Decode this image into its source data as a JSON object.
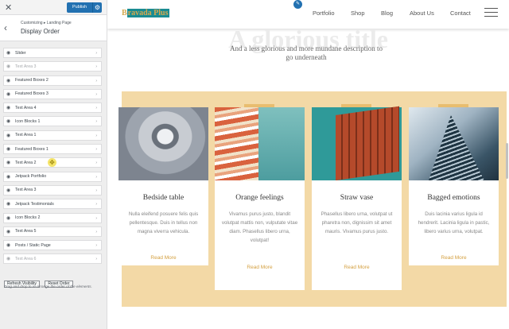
{
  "customizer": {
    "close_icon": "close-icon",
    "publish_label": "Publish",
    "gear_icon": "gear-icon",
    "breadcrumb": "Customizing ▸ Landing Page",
    "panel_title": "Display Order",
    "items": [
      {
        "label": "Slider",
        "visible": true
      },
      {
        "label": "Text Area 3",
        "visible": false
      },
      {
        "label": "Featured Boxes 2",
        "visible": true
      },
      {
        "label": "Featured Boxes 3",
        "visible": true
      },
      {
        "label": "Text Area 4",
        "visible": true
      },
      {
        "label": "Icon Blocks 1",
        "visible": true
      },
      {
        "label": "Text Area 1",
        "visible": true
      },
      {
        "label": "Featured Boxes 1",
        "visible": true
      },
      {
        "label": "Text Area 2",
        "visible": true
      },
      {
        "label": "Jetpack Portfolio",
        "visible": true
      },
      {
        "label": "Text Area 3",
        "visible": true
      },
      {
        "label": "Jetpack Testimonials",
        "visible": true
      },
      {
        "label": "Icon Blocks 2",
        "visible": true
      },
      {
        "label": "Text Area 5",
        "visible": true
      },
      {
        "label": "Posts / Static Page",
        "visible": true
      },
      {
        "label": "Text Area 6",
        "visible": false
      }
    ],
    "refresh_label": "Refresh Visibility",
    "reset_label": "Reset Order",
    "description": "Drag and drop to re-arrange the order of the elements."
  },
  "site": {
    "logo_prefix": "B",
    "logo_highlight": "ravada Plus",
    "nav": [
      "Portfolio",
      "Shop",
      "Blog",
      "About Us",
      "Contact"
    ],
    "hero_title": "A glorious title",
    "hero_subtitle": "And a less glorious and more mundane description to go underneath",
    "accent_color": "#d4a041",
    "band_color": "#f3d9a6",
    "cards": [
      {
        "title": "Bedside table",
        "desc": "Nulla eleifend posuere felis quis pellentesque. Duis in tellus non magna viverra vehicula.",
        "link": "Read More"
      },
      {
        "title": "Orange feelings",
        "desc": "Vivamus purus justo, blandit volutpat mattis non, vulputate vitae diam. Phasellus libero urna, volutpat!",
        "link": "Read More"
      },
      {
        "title": "Straw vase",
        "desc": "Phasellus libero urna, volutpat ut pharetra non, dignissim sit amet mauris. Vivamus purus justo.",
        "link": "Read More"
      },
      {
        "title": "Bagged emotions",
        "desc": "Duis lacinia varius ligula id hendrerit. Lacinia ligula in pastic, libero varius urna, volutpat.",
        "link": "Read More"
      }
    ]
  }
}
